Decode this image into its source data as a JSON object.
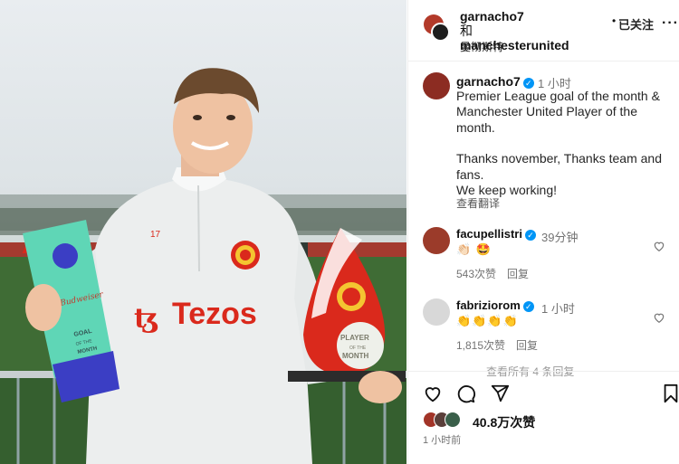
{
  "header": {
    "author": "garnacho7",
    "joiner": "和",
    "coauthor": "manchesterunited",
    "location": "曼彻斯特",
    "dot": "•",
    "follow_label": "已关注",
    "more_label": "···"
  },
  "caption": {
    "username": "garnacho7",
    "time": "1 小时",
    "lines": [
      "Premier League goal of the month & Manchester United Player of the month.",
      "Thanks november, Thanks team and fans.",
      "We keep working!"
    ],
    "translate_label": "查看翻译"
  },
  "comments": [
    {
      "username": "facupellistri",
      "time": "39分钟",
      "emojis": "👏🏻 🤩",
      "likes": "543次赞",
      "reply_label": "回复"
    },
    {
      "username": "fabriziorom",
      "time": "1 小时",
      "emojis": "👏👏👏👏",
      "likes": "1,815次赞",
      "reply_label": "回复"
    }
  ],
  "faded_text": "查看所有 4 条回复",
  "actions": {
    "likes_text": "40.8万次赞",
    "posted_time": "1 小时前"
  },
  "photo": {
    "shirt_sponsor": "Tezos",
    "shirt_number": "17",
    "trophy_brand": "Budweiser",
    "trophy_goal": "GOAL",
    "trophy_of": "OF THE",
    "trophy_month": "MONTH",
    "award_player": "PLAYER",
    "award_of": "OF THE",
    "award_month": "MONTH"
  },
  "colors": {
    "accent_blue": "#0095f6",
    "mu_red": "#da291c",
    "trophy_teal": "#5fd6b6"
  }
}
